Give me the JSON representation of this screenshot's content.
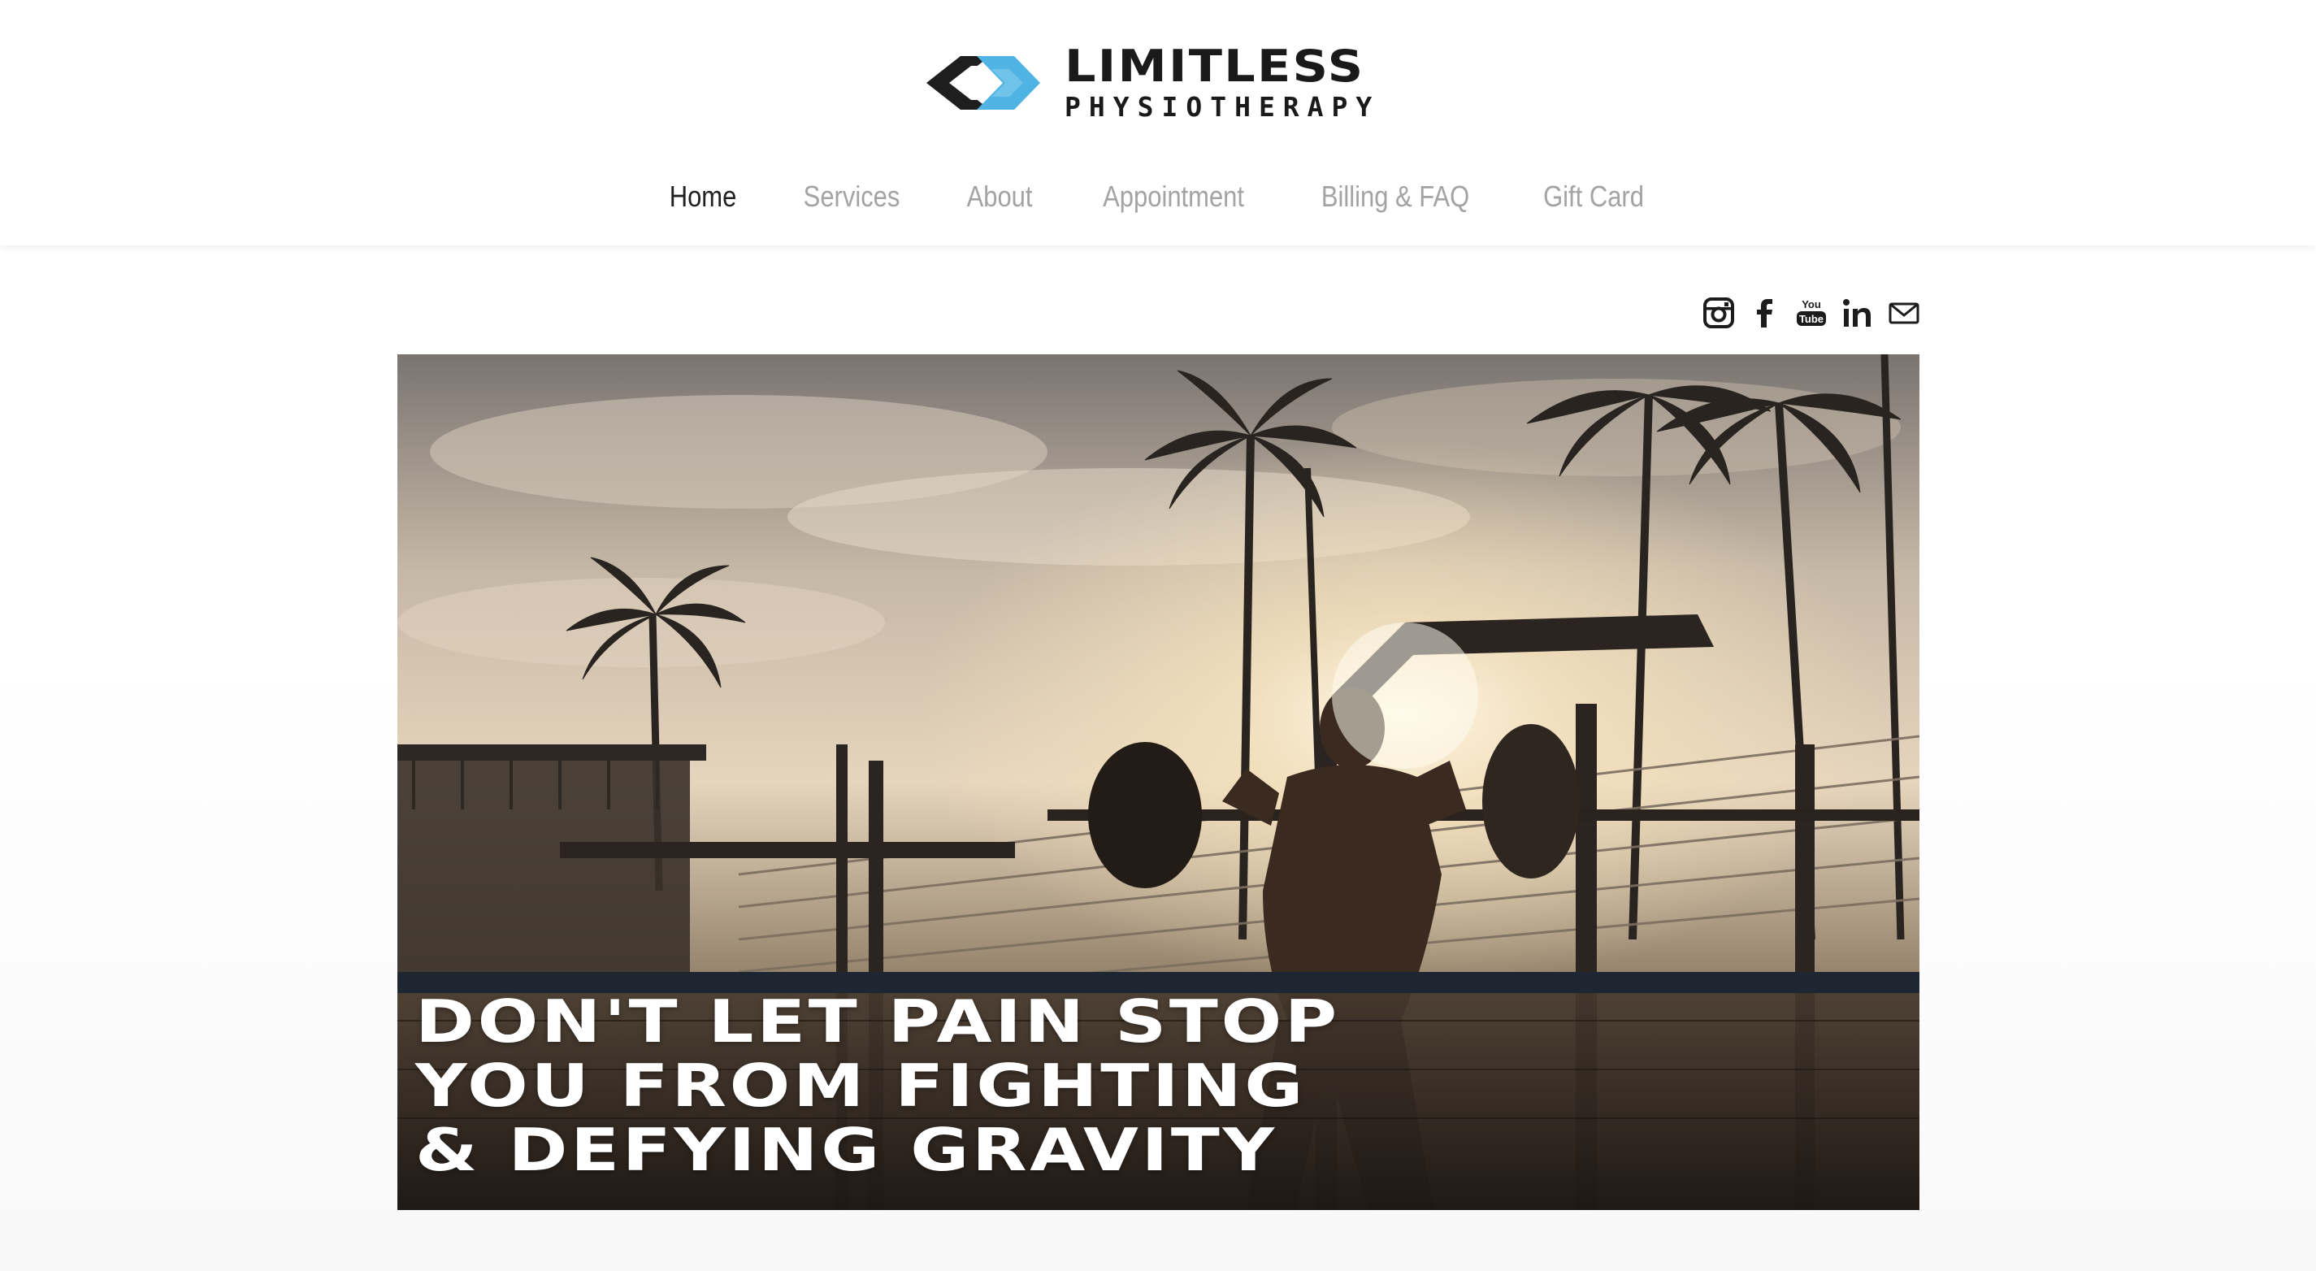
{
  "brand": {
    "name": "LIMITLESS",
    "tagline": "PHYSIOTHERAPY",
    "colors": {
      "accent": "#4fb3e3",
      "dark": "#1a1a1a"
    }
  },
  "nav": {
    "items": [
      {
        "label": "Home",
        "active": true
      },
      {
        "label": "Services",
        "active": false
      },
      {
        "label": "About",
        "active": false
      },
      {
        "label": "Appointment",
        "active": false
      },
      {
        "label": "Billing & FAQ",
        "active": false
      },
      {
        "label": "Gift Card",
        "active": false
      }
    ],
    "colors": {
      "active": "#1f1f1f",
      "inactive": "#a3a3a3"
    }
  },
  "social": {
    "icons": [
      "instagram-icon",
      "facebook-icon",
      "youtube-icon",
      "linkedin-icon",
      "email-icon"
    ]
  },
  "hero": {
    "headline_lines": [
      "DON'T LET PAIN STOP",
      "YOU FROM FIGHTING",
      "& DEFYING GRAVITY"
    ],
    "image_subject": "person-squatting-barbell-outdoor-gym-sunset"
  }
}
